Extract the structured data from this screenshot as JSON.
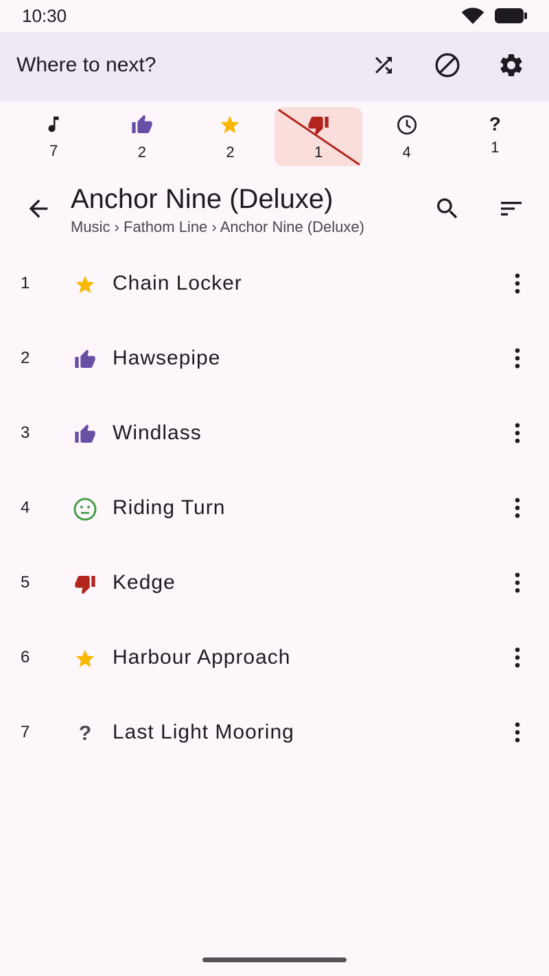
{
  "status_bar": {
    "time": "10:30"
  },
  "top_bar": {
    "title": "Where to next?",
    "actions": [
      "shuffle-icon",
      "block-icon",
      "settings-icon"
    ]
  },
  "filters": [
    {
      "icon": "music-note-icon",
      "count": "7",
      "active": false
    },
    {
      "icon": "thumb-up-icon",
      "count": "2",
      "active": false
    },
    {
      "icon": "star-icon",
      "count": "2",
      "active": false
    },
    {
      "icon": "thumb-down-icon",
      "count": "1",
      "active": true,
      "excluded": true
    },
    {
      "icon": "clock-icon",
      "count": "4",
      "active": false
    },
    {
      "icon": "question-icon",
      "count": "1",
      "active": false
    }
  ],
  "album": {
    "title": "Anchor Nine (Deluxe)",
    "breadcrumb": "Music › Fathom Line › Anchor Nine (Deluxe)"
  },
  "tracks": [
    {
      "number": "1",
      "rating_icon": "star-icon",
      "title": "Chain Locker"
    },
    {
      "number": "2",
      "rating_icon": "thumb-up-icon",
      "title": "Hawsepipe"
    },
    {
      "number": "3",
      "rating_icon": "thumb-up-icon",
      "title": "Windlass"
    },
    {
      "number": "4",
      "rating_icon": "neutral-face-icon",
      "title": "Riding Turn"
    },
    {
      "number": "5",
      "rating_icon": "thumb-down-icon",
      "title": "Kedge"
    },
    {
      "number": "6",
      "rating_icon": "star-icon",
      "title": "Harbour Approach"
    },
    {
      "number": "7",
      "rating_icon": "question-icon",
      "title": "Last Light Mooring"
    }
  ],
  "colors": {
    "background": "#fdf7fc",
    "top_bar": "#efe9f4",
    "thumb_up": "#6750a4",
    "star": "#f9b800",
    "thumb_down": "#b3261e",
    "neutral": "#43a047",
    "active_filter_bg": "#f9dedc"
  }
}
